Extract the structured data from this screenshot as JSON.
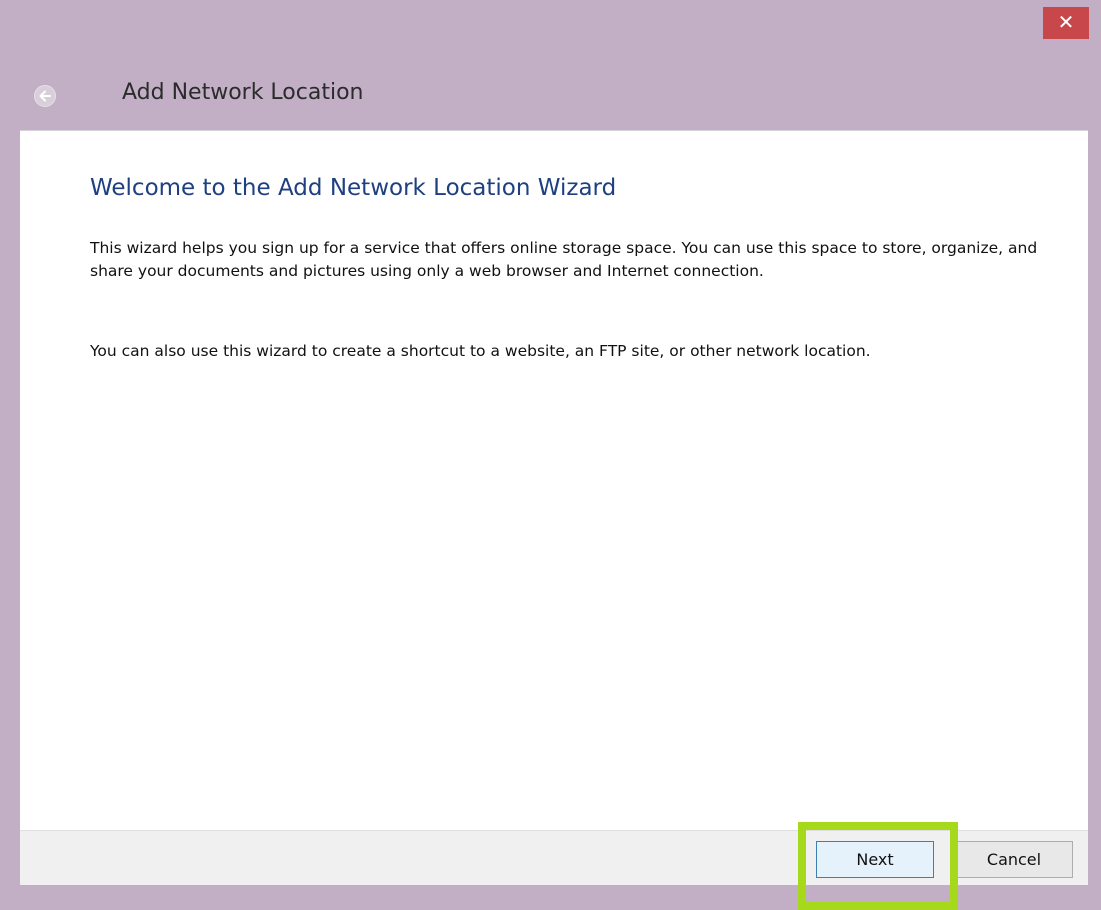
{
  "window": {
    "title": "Add Network Location",
    "close_label": "✕"
  },
  "icons": {
    "back": "back-arrow-icon",
    "close": "close-icon"
  },
  "content": {
    "heading": "Welcome to the Add Network Location Wizard",
    "paragraph1": "This wizard helps you sign up for a service that offers online storage space.  You can use this space to store, organize, and share your documents and pictures using only a web browser and Internet connection.",
    "paragraph2": "You can also use this wizard to create a shortcut to a website, an FTP site, or other network location."
  },
  "footer": {
    "next_label": "Next",
    "cancel_label": "Cancel"
  },
  "colors": {
    "title_bar": "#c2afc6",
    "close_button": "#c7474a",
    "heading": "#1e3f80",
    "highlight": "#a6d91b"
  }
}
